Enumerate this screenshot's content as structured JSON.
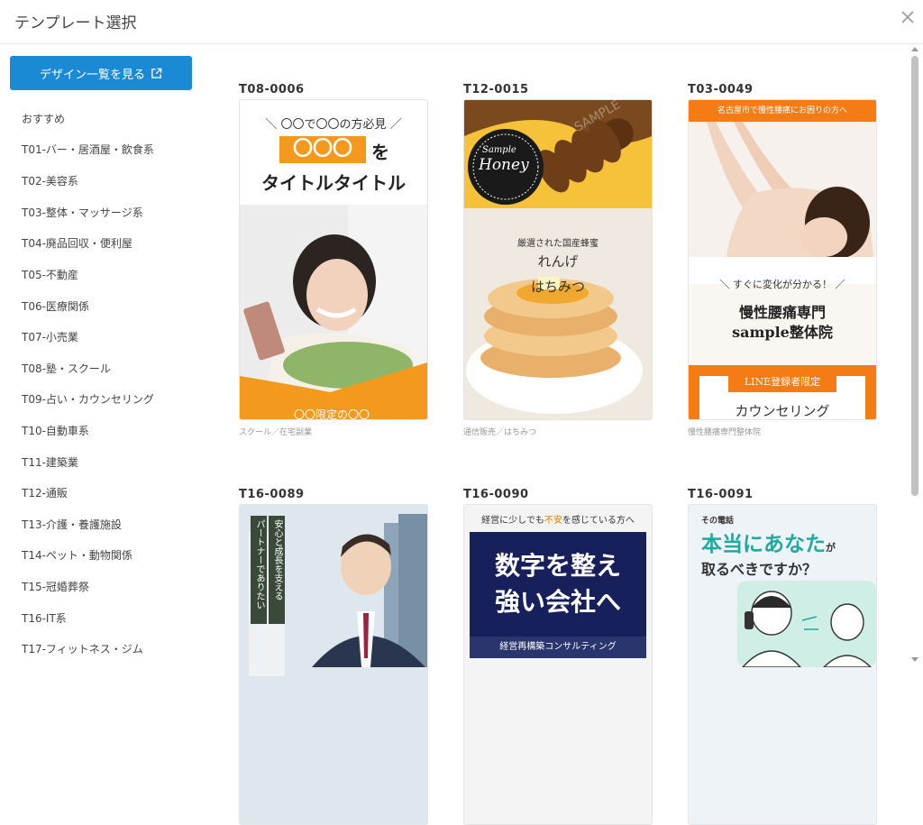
{
  "header": {
    "title": "テンプレート選択",
    "close_icon": "close-icon"
  },
  "sidebar": {
    "list_button_label": "デザイン一覧を見る",
    "list_button_icon": "external-link-icon",
    "accent": "#1a8ad4",
    "categories": [
      "おすすめ",
      "T01-バー・居酒屋・飲食系",
      "T02-美容系",
      "T03-整体・マッサージ系",
      "T04-廃品回収・便利屋",
      "T05-不動産",
      "T06-医療関係",
      "T07-小売業",
      "T08-塾・スクール",
      "T09-占い・カウンセリング",
      "T10-自動車系",
      "T11-建築業",
      "T12-通販",
      "T13-介護・養護施設",
      "T14-ペット・動物関係",
      "T15-冠婚葬祭",
      "T16-IT系",
      "T17-フィットネス・ジム"
    ]
  },
  "templates": [
    {
      "code": "T08-0006",
      "caption": "スクール／在宅副業",
      "texts": [
        "＼ 〇〇で〇〇の方必見 ／",
        "〇〇〇",
        "を",
        "タイトルタイトル",
        "〇〇限定の〇〇"
      ]
    },
    {
      "code": "T12-0015",
      "caption": "通信販売／はちみつ",
      "texts": [
        "Sample",
        "Honey",
        "厳選された国産蜂蜜",
        "れんげ",
        "はちみつ",
        "SAMPLE"
      ]
    },
    {
      "code": "T03-0049",
      "caption": "慢性腰痛専門整体院",
      "texts": [
        "名古屋市で慢性腰痛にお困りの方へ",
        "＼ すぐに変化が分かる！ ／",
        "慢性腰痛専門",
        "sample整体院",
        "LINE登録者限定",
        "カウンセリング"
      ]
    },
    {
      "code": "T16-0089",
      "caption": "",
      "texts": [
        "安心と成長を支える",
        "パートナーでありたい"
      ]
    },
    {
      "code": "T16-0090",
      "caption": "",
      "texts": [
        "経営に少しでも",
        "不安",
        "を感じている方へ",
        "数字を整え",
        "強い会社へ",
        "経営再構築コンサルティング"
      ]
    },
    {
      "code": "T16-0091",
      "caption": "",
      "texts": [
        "その電話",
        "本当にあなた",
        "が",
        "取るべきですか？"
      ]
    }
  ]
}
